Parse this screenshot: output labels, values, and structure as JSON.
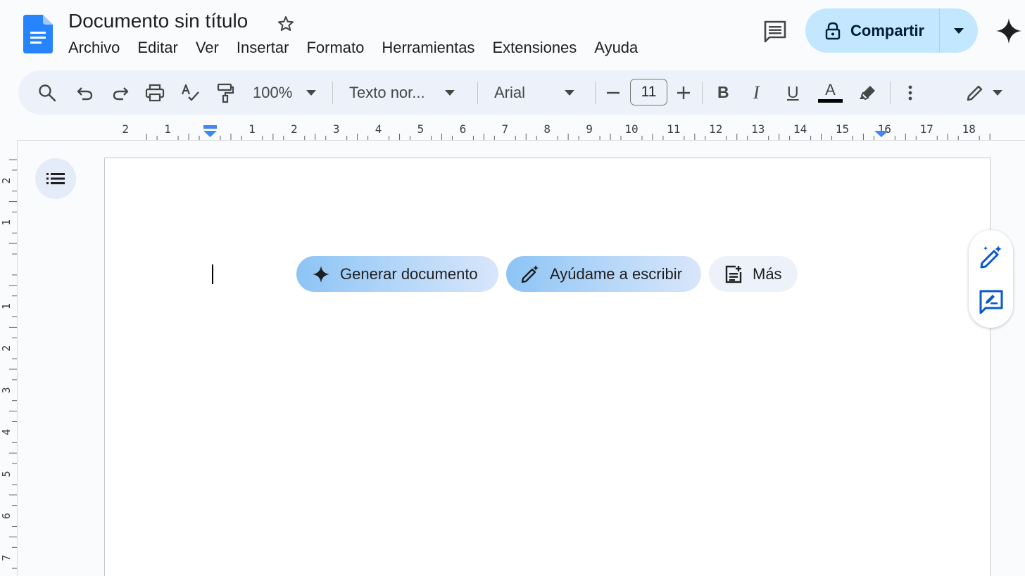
{
  "header": {
    "doc_title": "Documento sin título",
    "menu": [
      "Archivo",
      "Editar",
      "Ver",
      "Insertar",
      "Formato",
      "Herramientas",
      "Extensiones",
      "Ayuda"
    ],
    "share_label": "Compartir"
  },
  "toolbar": {
    "zoom": "100%",
    "style": "Texto nor...",
    "font": "Arial",
    "font_size": "11",
    "bold": "B",
    "italic": "I",
    "underline": "U",
    "text_color_glyph": "A"
  },
  "ruler": {
    "horizontal_labels": [
      "2",
      "1",
      "1",
      "2",
      "3",
      "4",
      "5",
      "6",
      "7",
      "8",
      "9",
      "10",
      "11",
      "12",
      "13",
      "14",
      "15",
      "16",
      "17",
      "18"
    ],
    "vertical_labels": [
      "2",
      "1",
      "1",
      "2",
      "3",
      "4",
      "5",
      "6",
      "7"
    ]
  },
  "chips": {
    "generate": "Generar documento",
    "help_write": "Ayúdame a escribir",
    "more": "Más"
  },
  "colors": {
    "accent": "#0b57d0",
    "share_bg": "#c2e7ff",
    "toolbar_bg": "#edf2fa",
    "page_bg": "#f9fbfd"
  }
}
